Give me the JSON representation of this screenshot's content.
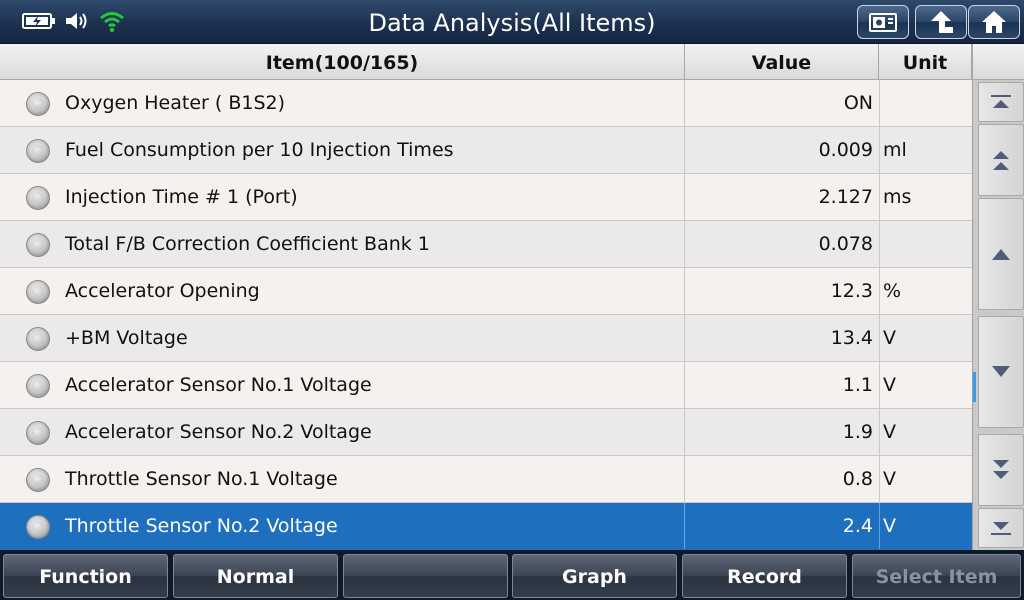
{
  "header": {
    "title": "Data Analysis(All Items)",
    "status_icons": [
      "battery-charging-icon",
      "speaker-icon",
      "wifi-icon"
    ],
    "buttons": [
      {
        "icon": "screenshot-icon"
      },
      {
        "icon": "back-arrow-icon"
      },
      {
        "icon": "home-icon"
      }
    ]
  },
  "table": {
    "columns": {
      "item": "Item(100/165)",
      "value": "Value",
      "unit": "Unit"
    },
    "rows": [
      {
        "name": "Oxygen Heater ( B1S2)",
        "value": "ON",
        "unit": ""
      },
      {
        "name": "Fuel Consumption per 10 Injection Times",
        "value": "0.009",
        "unit": "ml"
      },
      {
        "name": "Injection Time # 1 (Port)",
        "value": "2.127",
        "unit": "ms"
      },
      {
        "name": "Total F/B Correction Coefficient Bank 1",
        "value": "0.078",
        "unit": ""
      },
      {
        "name": "Accelerator Opening",
        "value": "12.3",
        "unit": "%"
      },
      {
        "name": "+BM Voltage",
        "value": "13.4",
        "unit": "V"
      },
      {
        "name": "Accelerator Sensor No.1 Voltage",
        "value": "1.1",
        "unit": "V"
      },
      {
        "name": "Accelerator Sensor No.2 Voltage",
        "value": "1.9",
        "unit": "V"
      },
      {
        "name": "Throttle Sensor No.1 Voltage",
        "value": "0.8",
        "unit": "V"
      },
      {
        "name": "Throttle Sensor No.2 Voltage",
        "value": "2.4",
        "unit": "V"
      }
    ],
    "selected_row": 9
  },
  "scroll": {
    "buttons": [
      "scroll-top-icon",
      "page-up-icon",
      "line-up-icon",
      "line-down-icon",
      "page-down-icon",
      "scroll-bottom-icon"
    ]
  },
  "toolbar": {
    "function_label": "Function",
    "normal_label": "Normal",
    "empty_label": "",
    "graph_label": "Graph",
    "record_label": "Record",
    "select_item_label": "Select Item"
  },
  "colors": {
    "selected_row": "#1f6fbf",
    "title_bar": "#1d3250",
    "wifi": "#22c83a"
  }
}
